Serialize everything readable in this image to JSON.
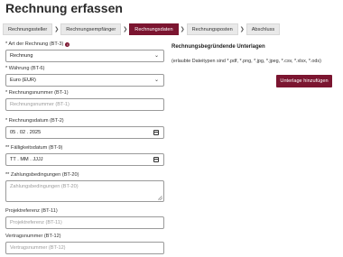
{
  "page": {
    "title": "Rechnung erfassen"
  },
  "stepper": {
    "steps": [
      {
        "label": "Rechnungssteller"
      },
      {
        "label": "Rechnungsempfänger"
      },
      {
        "label": "Rechnungsdaten"
      },
      {
        "label": "Rechnungsposten"
      },
      {
        "label": "Abschluss"
      }
    ],
    "active_index": 2,
    "separator": "❯"
  },
  "form": {
    "invoice_type": {
      "label": "* Art der Rechnung (BT-3)",
      "value": "Rechnung"
    },
    "currency": {
      "label": "* Währung (BT-6)",
      "value": "Euro (EUR)"
    },
    "invoice_number": {
      "label": "* Rechnungsnummer (BT-1)",
      "placeholder": "Rechnungsnummer (BT-1)"
    },
    "invoice_date": {
      "label": "* Rechnungsdatum (BT-2)",
      "value": "05 . 02 . 2025"
    },
    "due_date": {
      "label": "** Fälligkeitsdatum (BT-9)",
      "value": "TT . MM . JJJJ"
    },
    "payment_terms": {
      "label": "** Zahlungsbedingungen (BT-20)",
      "placeholder": "Zahlungsbedingungen (BT-20)"
    },
    "project_reference": {
      "label": "Projektreferenz (BT-11)",
      "placeholder": "Projektreferenz (BT-11)"
    },
    "contract_number": {
      "label": "Vertragsnummer (BT-12)",
      "placeholder": "Vertragsnummer (BT-12)"
    }
  },
  "icons": {
    "info": "info-icon",
    "select": "chevron-down-icon",
    "date": "calendar-icon"
  },
  "upload": {
    "title": "Rechnungsbegründende Unterlagen",
    "hint": "(erlaubte Dateitypen sind *.pdf, *.png, *.jpg, *.jpeg, *.csv, *.xlsx, *.ods)",
    "button_label": "Unterlage hinzufügen"
  },
  "colors": {
    "accent": "#7b1530",
    "step_bg": "#e9e9e9",
    "border": "#9a9a9a",
    "placeholder": "#9c9c9c"
  }
}
